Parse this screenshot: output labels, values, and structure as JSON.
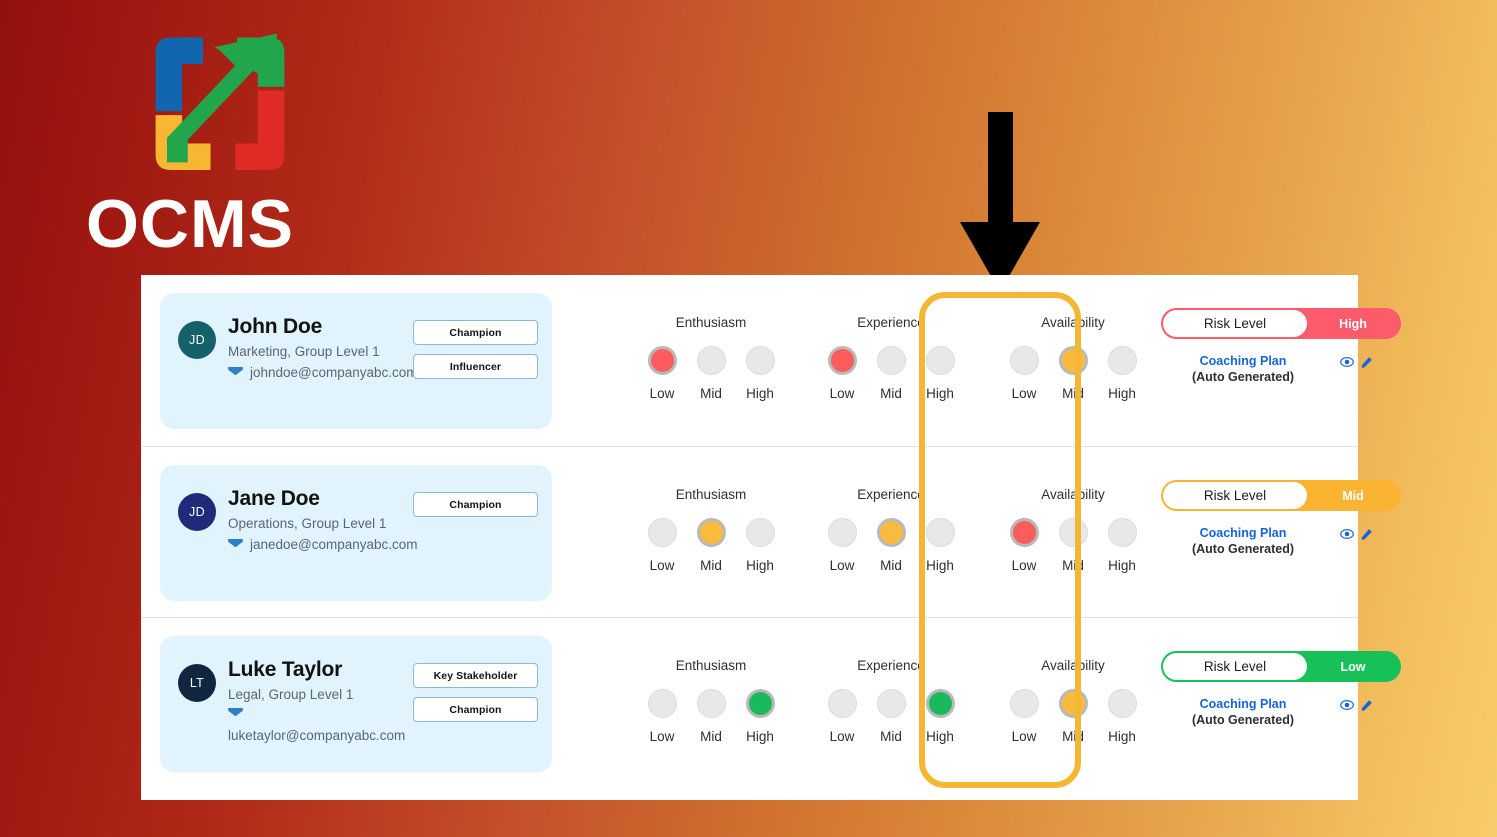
{
  "brand": {
    "name": "OCMS",
    "logo_icon": "ocms-expand-arrow-logo",
    "colors": {
      "blue": "#1266b0",
      "green": "#22a64b",
      "yellow": "#f7b733",
      "red": "#e02a26"
    }
  },
  "annotation": {
    "arrow_icon": "down-arrow-annotation",
    "highlight_color": "#f5b731",
    "highlight_target": "Availability"
  },
  "palette": {
    "low": "#fc5c5c",
    "mid": "#f8bb3d",
    "high": "#1cb85c",
    "empty": "#e8e8e8",
    "card_bg": "#e1f3fc",
    "link": "#1565d8"
  },
  "metric_labels": [
    "Low",
    "Mid",
    "High"
  ],
  "columns": {
    "enthusiasm": "Enthusiasm",
    "experience": "Experience",
    "availability": "Availability"
  },
  "risk": {
    "label": "Risk Level",
    "coaching_link": "Coaching Plan",
    "coaching_sub": "(Auto Generated)",
    "view_icon": "eye-icon",
    "edit_icon": "pencil-icon"
  },
  "rows": [
    {
      "initials": "JD",
      "avatar_color": "#14616b",
      "name": "John Doe",
      "role": "Marketing, Group Level 1",
      "email": "johndoe@companyabc.com",
      "email_wraps": false,
      "tags": [
        "Champion",
        "Influencer"
      ],
      "enthusiasm": "Low",
      "experience": "Low",
      "availability": "Mid",
      "risk_value": "High",
      "risk_color": "#fb5b6b"
    },
    {
      "initials": "JD",
      "avatar_color": "#1f2a7a",
      "name": "Jane Doe",
      "role": "Operations, Group Level 1",
      "email": "janedoe@companyabc.com",
      "email_wraps": false,
      "tags": [
        "Champion"
      ],
      "enthusiasm": "Mid",
      "experience": "Mid",
      "availability": "Low",
      "risk_value": "Mid",
      "risk_color": "#fbb431"
    },
    {
      "initials": "LT",
      "avatar_color": "#10263f",
      "name": "Luke Taylor",
      "role": "Legal, Group Level 1",
      "email": "luketaylor@companyabc.com",
      "email_wraps": true,
      "tags": [
        "Key Stakeholder",
        "Champion"
      ],
      "enthusiasm": "High",
      "experience": "High",
      "availability": "Mid",
      "risk_value": "Low",
      "risk_color": "#18c058"
    }
  ]
}
